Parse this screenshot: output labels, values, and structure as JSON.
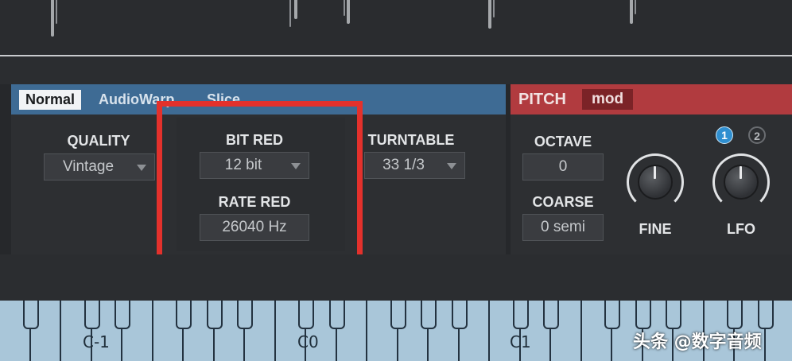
{
  "mode_tabs": [
    {
      "label": "Normal",
      "active": true
    },
    {
      "label": "AudioWarp",
      "active": false
    },
    {
      "label": "Slice",
      "active": false
    }
  ],
  "quality": {
    "label": "QUALITY",
    "value": "Vintage"
  },
  "bit_red": {
    "label": "BIT RED",
    "value": "12 bit"
  },
  "rate_red": {
    "label": "RATE RED",
    "value": "26040 Hz"
  },
  "turntable": {
    "label": "TURNTABLE",
    "value": "33 1/3"
  },
  "pitch": {
    "title": "PITCH",
    "mod_label": "mod",
    "octave": {
      "label": "OCTAVE",
      "value": "0"
    },
    "coarse": {
      "label": "COARSE",
      "value": "0 semi"
    },
    "fine_label": "FINE",
    "lfo_label": "LFO",
    "lfo_buttons": [
      "1",
      "2"
    ],
    "lfo_selected": "1"
  },
  "keyboard": {
    "octave_labels": [
      "C-1",
      "C0",
      "C1"
    ]
  },
  "watermark": "头条 @数字音频",
  "colors": {
    "mode_header": "#3e6b94",
    "pitch_header": "#b13b3f",
    "highlight": "#e3312c",
    "keys": "#a9c6d9"
  }
}
